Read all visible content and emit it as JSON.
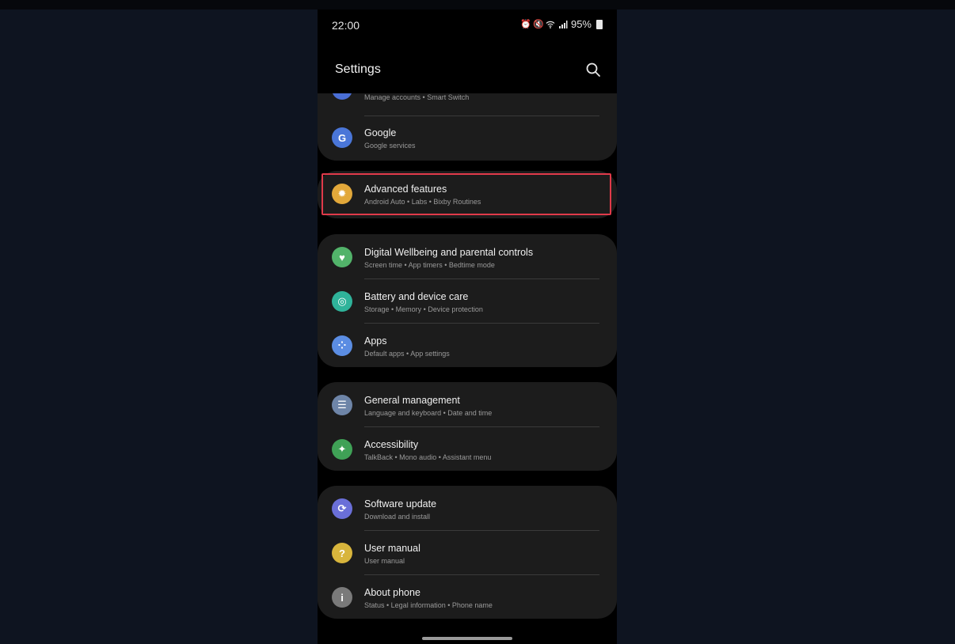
{
  "status_bar": {
    "time": "22:00",
    "battery": "95%"
  },
  "header": {
    "title": "Settings"
  },
  "groups": [
    {
      "items": [
        {
          "label": "",
          "sub": "Manage accounts • Smart Switch",
          "icon": "accounts-icon",
          "color": "#4a6fd6"
        },
        {
          "label": "Google",
          "sub": "Google services",
          "icon": "google-icon",
          "color": "#4a76d8"
        }
      ]
    },
    {
      "items": [
        {
          "label": "Advanced features",
          "sub": "Android Auto • Labs • Bixby Routines",
          "icon": "advanced-features-icon",
          "color": "#e2a83a"
        }
      ]
    },
    {
      "items": [
        {
          "label": "Digital Wellbeing and parental controls",
          "sub": "Screen time • App timers • Bedtime mode",
          "icon": "wellbeing-icon",
          "color": "#52b36a"
        },
        {
          "label": "Battery and device care",
          "sub": "Storage • Memory • Device protection",
          "icon": "device-care-icon",
          "color": "#2fb39a"
        },
        {
          "label": "Apps",
          "sub": "Default apps • App settings",
          "icon": "apps-icon",
          "color": "#5b8de3"
        }
      ]
    },
    {
      "items": [
        {
          "label": "General management",
          "sub": "Language and keyboard • Date and time",
          "icon": "general-management-icon",
          "color": "#6e85a8"
        },
        {
          "label": "Accessibility",
          "sub": "TalkBack • Mono audio • Assistant menu",
          "icon": "accessibility-icon",
          "color": "#3fa156"
        }
      ]
    },
    {
      "items": [
        {
          "label": "Software update",
          "sub": "Download and install",
          "icon": "software-update-icon",
          "color": "#6a6fd8"
        },
        {
          "label": "User manual",
          "sub": "User manual",
          "icon": "user-manual-icon",
          "color": "#d8b53c"
        },
        {
          "label": "About phone",
          "sub": "Status • Legal information • Phone name",
          "icon": "about-phone-icon",
          "color": "#7a7a7a"
        }
      ]
    }
  ],
  "colors": {
    "highlight": "#e03a4a",
    "card": "#1c1c1c",
    "background": "#000000"
  }
}
